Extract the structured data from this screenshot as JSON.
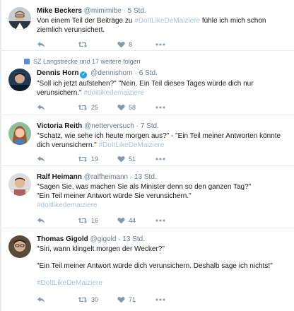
{
  "tweets": [
    {
      "name": "Mike Beckers",
      "handle": "@mimimibe",
      "time": "· 5 Std.",
      "verified": false,
      "text_before": "Von einem Teil der Beiträge zu ",
      "hashtag": "#DoItLikeDeMaiziere",
      "text_after": " fühle ich mich schon ziemlich verunsichert.",
      "retweets": "",
      "likes": "8"
    },
    {
      "context": "SZ Langstrecke und 17 weitere folgen",
      "name": "Dennis Horn",
      "handle": "@dennishorn",
      "time": "· 6 Std.",
      "verified": true,
      "line1": "\"Soll ich jetzt aufstehen?\" \"Nein. Ein Teil dieses Tages würde dich nur verunsichern.\" ",
      "hashtag": "#doitlikedemaiziere",
      "retweets": "25",
      "likes": "58"
    },
    {
      "name": "Victoria Reith",
      "handle": "@netterversuch",
      "time": "· 7 Std.",
      "verified": false,
      "line1": "\"Schatz, wie sehe ich heute morgen aus?\" - \"Ein Teil meiner Antworten könnte dich verunsichern.\" ",
      "hashtag": "#DoItLikeDeMaiziere",
      "retweets": "19",
      "likes": "51"
    },
    {
      "name": "Ralf Heimann",
      "handle": "@ralfheimann",
      "time": "· 13 Std.",
      "verified": false,
      "line1": "\"Sagen Sie, was machen Sie als Minister denn so den ganzen Tag?\"",
      "line2": "\"Ein Teil meiner Antwort würde Sie verunsichern.\"",
      "hashtag": "#doitlikedemaiziere",
      "retweets": "16",
      "likes": "44"
    },
    {
      "name": "Thomas Gigold",
      "handle": "@gigold",
      "time": "· 13 Std.",
      "verified": false,
      "line1": "\"Siri, wann klingelt morgen der Wecker?\"",
      "line2": "\"Ein Teil meiner Antwort würde dich verunsichern. Deshalb sage ich nichts!\"",
      "hashtag": "#DoItLikeDeMaiziere",
      "retweets": "30",
      "likes": "71"
    }
  ],
  "icons": {
    "reply": "reply-icon",
    "retweet": "retweet-icon",
    "like": "heart-icon",
    "more": "more-icon"
  },
  "colors": {
    "hashtag": "#a9c3d7",
    "verified": "#1da1f2",
    "meta": "#657786"
  }
}
